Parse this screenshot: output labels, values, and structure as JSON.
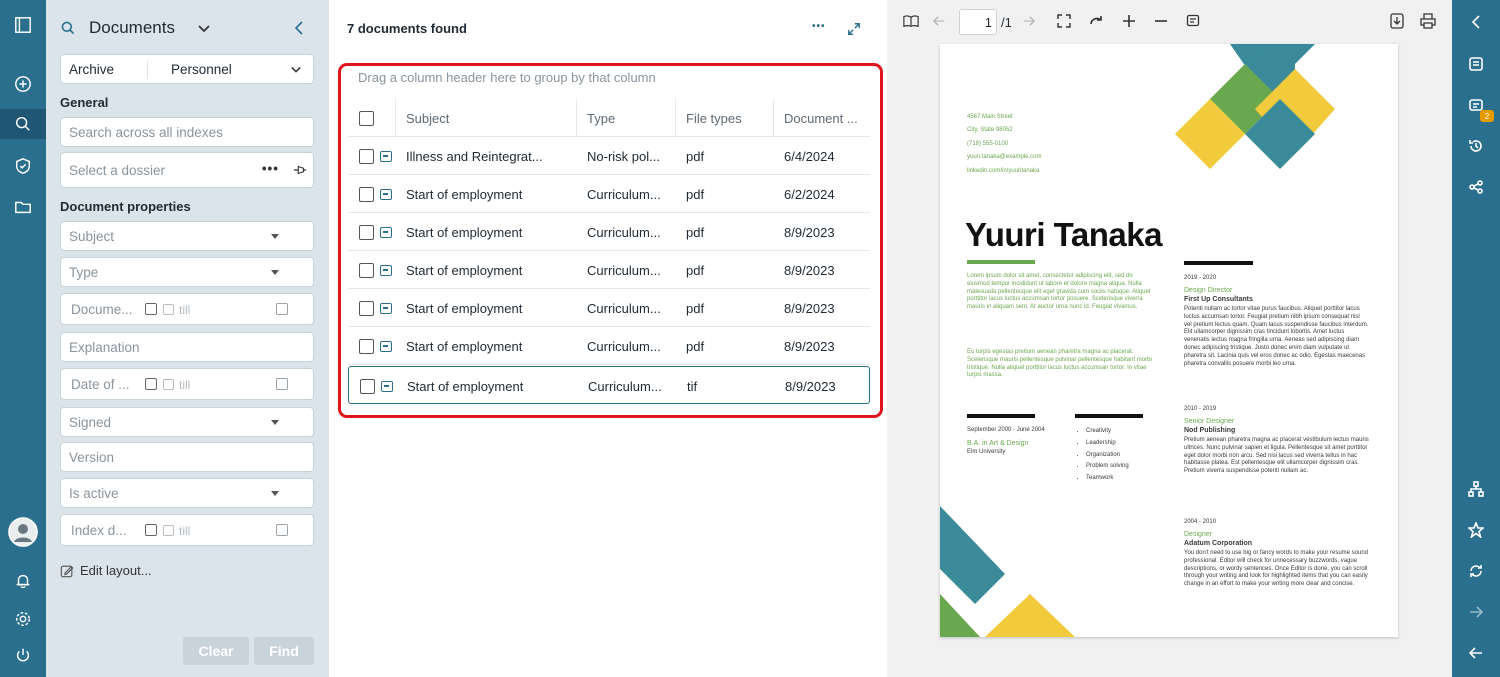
{
  "panel": {
    "title": "Documents",
    "archive_label": "Archive",
    "archive_value": "Personnel",
    "general_heading": "General",
    "search_placeholder": "Search across all indexes",
    "dossier_placeholder": "Select a dossier",
    "doc_props_heading": "Document properties",
    "fields": {
      "subject": "Subject",
      "type": "Type",
      "document": "Docume...",
      "explanation": "Explanation",
      "date_of": "Date of ...",
      "signed": "Signed",
      "version": "Version",
      "is_active": "Is active",
      "index_d": "Index d..."
    },
    "till": "till",
    "edit_layout": "Edit layout...",
    "clear": "Clear",
    "find": "Find"
  },
  "results": {
    "count_text": "7 documents found",
    "group_hint": "Drag a column header here to group by that column",
    "columns": [
      "Subject",
      "Type",
      "File types",
      "Document ..."
    ],
    "rows": [
      {
        "subject": "Illness and Reintegrat...",
        "type": "No-risk pol...",
        "filetype": "pdf",
        "date": "6/4/2024"
      },
      {
        "subject": "Start of employment",
        "type": "Curriculum...",
        "filetype": "pdf",
        "date": "6/2/2024"
      },
      {
        "subject": "Start of employment",
        "type": "Curriculum...",
        "filetype": "pdf",
        "date": "8/9/2023"
      },
      {
        "subject": "Start of employment",
        "type": "Curriculum...",
        "filetype": "pdf",
        "date": "8/9/2023"
      },
      {
        "subject": "Start of employment",
        "type": "Curriculum...",
        "filetype": "pdf",
        "date": "8/9/2023"
      },
      {
        "subject": "Start of employment",
        "type": "Curriculum...",
        "filetype": "pdf",
        "date": "8/9/2023"
      },
      {
        "subject": "Start of employment",
        "type": "Curriculum...",
        "filetype": "tif",
        "date": "8/9/2023"
      }
    ]
  },
  "viewer": {
    "page_current": "1",
    "page_total": "/1",
    "cv": {
      "address1": "4567 Main Street",
      "address2": "City, State 98052",
      "phone": "(718) 555-0100",
      "email": "yuuri.tanaka@example.com",
      "linkedin": "linkedin.com/in/yuuritanaka",
      "name": "Yuuri Tanaka",
      "intro": "Lorem ipsum dolor sit amet, consectetur adipiscing elit, sed do eiusmod tempor incididunt ut labore et dolore magna aliqua. Nulla malesuada pellentesque elit eget gravida cum sociis natoque. Aliquet porttitor lacus luctus accumsan tortor posuere. Scelerisque viverra mauris in aliquam sem. At auctor urna nunc id. Feugiat vivamus.",
      "intro2": "Eu turpis egestas pretium aenean pharetra magna ac placerat. Scelerisque mauris pellentesque pulvinar pellentesque habitant morbi tristique. Nulla aliquet porttitor lacus luctus accumsan tortor. In vitae turpis massa.",
      "edu_dates": "September 2000 - June 2004",
      "edu_degree": "B.A. in Art & Design",
      "edu_school": "Elm University",
      "skills": [
        "Creativity",
        "Leadership",
        "Organization",
        "Problem solving",
        "Teamwork"
      ],
      "jobs": [
        {
          "dates": "2019 - 2020",
          "title": "Design Director",
          "company": "First Up Consultants",
          "desc": "Potenti nullam ac tortor vitae purus faucibus. Aliquet porttitor lacus luctus accumsan tortor. Feugiat pretium nibh ipsum consequat nisl vel pretium lectus quam. Quam lacus suspendisse faucibus interdum. Elit ullamcorper dignissim cras tincidunt lobortis. Amet luctus venenatis lectus magna fringilla urna. Aeneas sed adipiscing diam donec adipiscing tristique. Justo donec enim diam vulputate ut pharetra sit. Lacinia quis vel eros donec ac odio. Egestas maecenas pharetra convallis posuere morbi leo urna."
        },
        {
          "dates": "2010 - 2019",
          "title": "Senior Designer",
          "company": "Nod Publishing",
          "desc": "Pretium aenean pharetra magna ac placerat vestibulum lectus mauris ultrices. Nunc pulvinar sapien et ligula. Pellentesque sit amet porttitor eget dolor morbi non arcu. Sed nisi lacus sed viverra tellus in hac habitasse platea. Est pellentesque elit ullamcorper dignissim cras. Pretium viverra suspendisse potenti nullam ac."
        },
        {
          "dates": "2004 - 2010",
          "title": "Designer",
          "company": "Adatum Corporation",
          "desc": "You don't need to use big or fancy words to make your resume sound professional. Editor will check for unnecessary buzzwords, vague descriptions, or wordy sentences. Once Editor is done, you can scroll through your writing and look for highlighted items that you can easily change in an effort to make your writing more clear and concise."
        }
      ]
    }
  },
  "right_rail": {
    "badge": "2"
  },
  "colors": {
    "rail": "#2b6f8f",
    "panel": "#dbe4ea",
    "highlight": "#e0141b",
    "teal": "#3a8a9a",
    "green": "#6aa84f",
    "yellow": "#f2cb3c"
  }
}
